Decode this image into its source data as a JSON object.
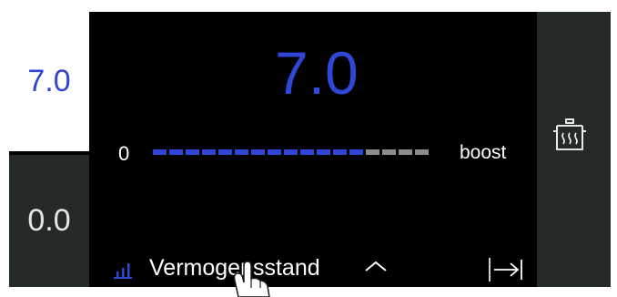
{
  "zones": {
    "active": {
      "value": "7.0"
    },
    "inactive": {
      "value": "0.0"
    }
  },
  "power": {
    "value": "7.0",
    "scale_min": "0",
    "scale_max": "boost",
    "level": 7.0,
    "segments_total": 17,
    "segments_filled": 13
  },
  "function": {
    "label": "Vermogensstand",
    "icon": "power-level-icon",
    "caret_icon": "chevron-up-icon"
  },
  "actions": {
    "end_icon": "arrow-to-end-icon",
    "pot_icon": "pot-icon"
  },
  "colors": {
    "accent": "#2f46d6",
    "inactive_segment": "#8c8c8c",
    "panel": "#242a29",
    "background": "#000000"
  }
}
